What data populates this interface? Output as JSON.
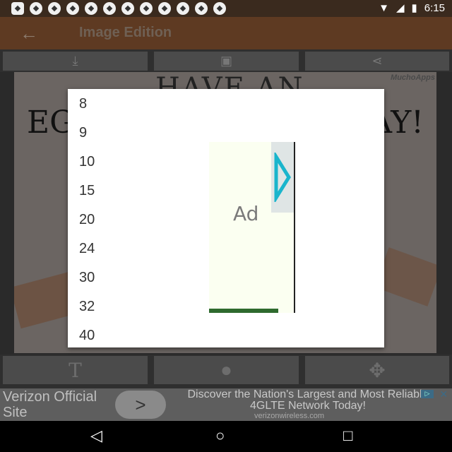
{
  "status": {
    "time": "6:15",
    "icons": [
      "chat-icon",
      "cloud-icon",
      "soccer-ball-icon",
      "wifi-icon",
      "signal-icon",
      "battery-icon"
    ]
  },
  "appbar": {
    "title": "Image Edition",
    "back_icon": "arrow-left-icon"
  },
  "toolbar_top": {
    "icons": [
      "download-icon",
      "image-add-icon",
      "share-icon"
    ]
  },
  "canvas": {
    "brand": "MuchoApps",
    "line1": "HAVE AN",
    "line2_left": "EGG",
    "line2_right": "AY!"
  },
  "toolbar_bottom": {
    "icons": [
      "text-icon",
      "palette-icon",
      "move-icon"
    ]
  },
  "dialog": {
    "options": [
      "8",
      "9",
      "10",
      "15",
      "20",
      "24",
      "30",
      "32",
      "40"
    ],
    "ad_label": "Ad"
  },
  "ad_banner": {
    "left_text": "Verizon Official Site",
    "right_text": "Discover the Nation's Largest and Most Reliable 4GLTE Network Today!",
    "url": "verizonwireless.com",
    "close": "✕"
  },
  "navbar": {
    "icons": [
      "back-icon",
      "home-icon",
      "recents-icon"
    ]
  }
}
